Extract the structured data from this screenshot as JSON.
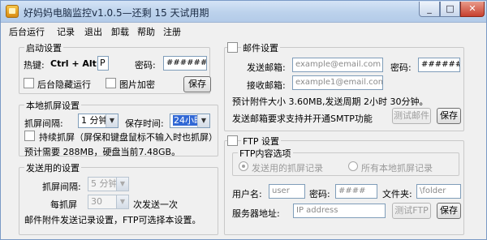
{
  "window": {
    "title": "好妈妈电脑监控v1.0.5—还剩 15 天试用期",
    "min_icon": "_",
    "max_icon": "□",
    "close_icon": "✕"
  },
  "menu": [
    "后台运行",
    "记录",
    "退出",
    "卸载",
    "帮助",
    "注册"
  ],
  "startup": {
    "legend": "启动设置",
    "hotkey_label": "热键:",
    "hotkey_combo": "Ctrl + Alt +",
    "hotkey_key": "P",
    "password_label": "密码:",
    "password_value": "######",
    "hide_label": "后台隐藏运行",
    "encrypt_label": "图片加密",
    "save_label": "保存"
  },
  "capture": {
    "legend": "本地抓屏设置",
    "interval_label": "抓屏间隔:",
    "interval_value": "1 分钟",
    "keep_label": "保存时间:",
    "keep_value": "24小时",
    "continuous_label": "持续抓屏（屏保和键盘鼠标不输入时也抓屏）",
    "estimate_text": "预计需要 288MB，硬盘当前7.48GB。"
  },
  "send": {
    "legend": "发送用的设置",
    "interval_label": "抓屏间隔:",
    "interval_value": "5 分钟",
    "every_label": "每抓屏",
    "count_value": "30",
    "send_once_label": "次发送一次",
    "note": "邮件附件发送记录设置，FTP可选择本设置。"
  },
  "mail": {
    "legend": "邮件设置",
    "sender_label": "发送邮箱:",
    "sender_placeholder": "example@email.com",
    "password_label": "密码:",
    "password_value": "######",
    "receiver_label": "接收邮箱:",
    "receiver_placeholder": "example1@email.com",
    "attachment_info": "预计附件大小 3.60MB,发送周期 2小时 30分钟。",
    "smtp_note": "发送邮箱要求支持并开通SMTP功能",
    "test_label": "测试邮件",
    "save_label": "保存"
  },
  "ftp": {
    "legend": "FTP 设置",
    "content_legend": "FTP内容选项",
    "opt_sent": "发送用的抓屏记录",
    "opt_all": "所有本地抓屏记录",
    "user_label": "用户名:",
    "user_value": "user",
    "password_label": "密码:",
    "password_value": "####",
    "folder_label": "文件夹:",
    "folder_value": "\\folder",
    "server_label": "服务器地址:",
    "server_placeholder": "IP address",
    "test_label": "测试FTP",
    "save_label": "保存"
  }
}
